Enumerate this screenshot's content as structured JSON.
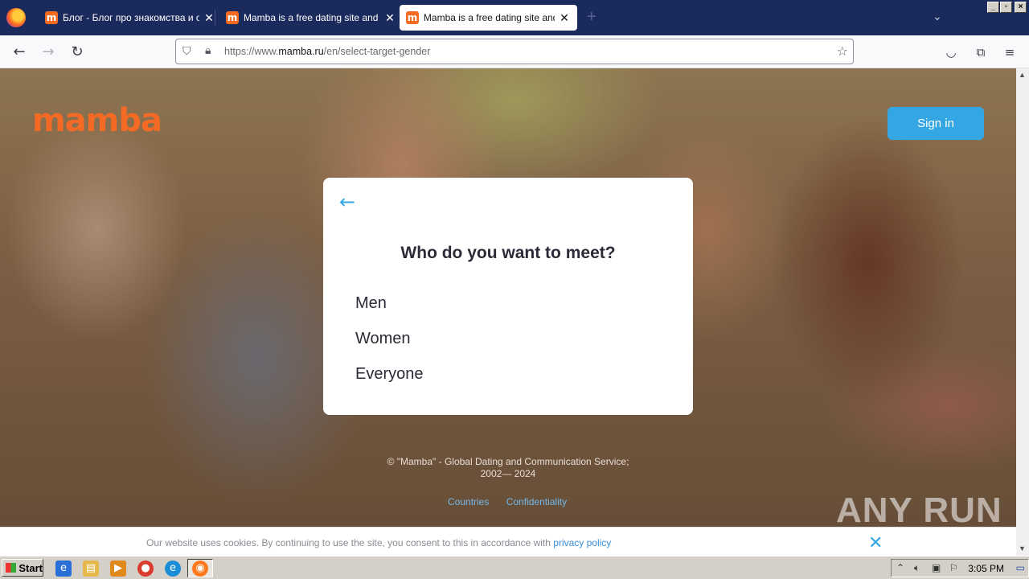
{
  "browser": {
    "tabs": [
      {
        "favicon": "m",
        "title": "Блог - Блог про знакомства и отношения",
        "close": "✕",
        "active": false
      },
      {
        "favicon": "m",
        "title": "Mamba is a free dating site and a chat",
        "close": "✕",
        "active": false
      },
      {
        "favicon": "m",
        "title": "Mamba is a free dating site and a chat",
        "close": "✕",
        "active": true
      }
    ],
    "new_tab": "+",
    "url_prefix": "https://www.",
    "url_domain": "mamba.ru",
    "url_path": "/en/select-target-gender",
    "icons": {
      "back": "back-arrow-icon",
      "forward": "forward-arrow-icon",
      "reload": "reload-icon",
      "shield": "shield-icon",
      "lock": "lock-icon",
      "star": "star-icon",
      "pocket": "pocket-icon",
      "extensions": "extensions-icon",
      "menu": "hamburger-menu-icon"
    }
  },
  "page": {
    "logo": "mamba",
    "sign_in": "Sign in",
    "card": {
      "title": "Who do you want to meet?",
      "options": [
        "Men",
        "Women",
        "Everyone"
      ]
    },
    "copyright_line1": "© \"Mamba\" - Global Dating and Communication Service;",
    "copyright_line2": "2002— 2024",
    "footer_links": [
      "Countries",
      "Confidentiality"
    ],
    "watermark": "ANY RUN",
    "cookie": {
      "text": "Our website uses cookies. By continuing to use the site, you consent to this in accordance with ",
      "link": "privacy policy",
      "close": "✕"
    },
    "colors": {
      "brand": "#f46a25",
      "accent": "#35a6e4"
    }
  },
  "taskbar": {
    "start": "Start",
    "clock": "3:05 PM",
    "apps": [
      "ie-icon",
      "explorer-icon",
      "media-player-icon",
      "chrome-icon",
      "edge-icon",
      "firefox-icon"
    ]
  }
}
